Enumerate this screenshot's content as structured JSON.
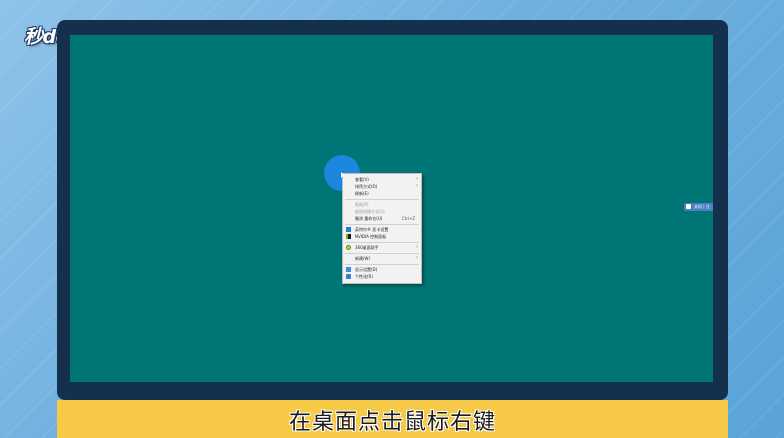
{
  "watermark": {
    "logo": "秒dong视频"
  },
  "subtitle": "在桌面点击鼠标右键",
  "tray": {
    "label": "关机 | 注"
  },
  "context_menu": {
    "items": [
      {
        "label": "查看(V)",
        "has_submenu": true,
        "disabled": false
      },
      {
        "label": "排序方式(O)",
        "has_submenu": true,
        "disabled": false
      },
      {
        "label": "刷新(E)",
        "has_submenu": false,
        "disabled": false
      },
      {
        "label": "粘贴(P)",
        "has_submenu": false,
        "disabled": true
      },
      {
        "label": "粘贴快捷方式(S)",
        "has_submenu": false,
        "disabled": true
      },
      {
        "label": "撤消 重命名(U)",
        "shortcut": "Ctrl+Z",
        "has_submenu": false,
        "disabled": false
      },
      {
        "label": "英特尔® 显卡设置",
        "icon": "intel-graphics-icon",
        "has_submenu": false,
        "disabled": false
      },
      {
        "label": "NVIDIA 控制面板",
        "icon": "nvidia-icon",
        "has_submenu": false,
        "disabled": false
      },
      {
        "label": "360桌面助手",
        "icon": "360-icon",
        "has_submenu": true,
        "disabled": false
      },
      {
        "label": "新建(W)",
        "has_submenu": true,
        "disabled": false
      },
      {
        "label": "显示设置(D)",
        "icon": "display-icon",
        "has_submenu": false,
        "disabled": false
      },
      {
        "label": "个性化(R)",
        "icon": "personalize-icon",
        "has_submenu": false,
        "disabled": false
      }
    ]
  },
  "colors": {
    "desktop": "#007575",
    "monitor_bezel": "#14304d",
    "subtitle_bar": "#f6c946",
    "cursor_highlight": "#1e88e5"
  }
}
